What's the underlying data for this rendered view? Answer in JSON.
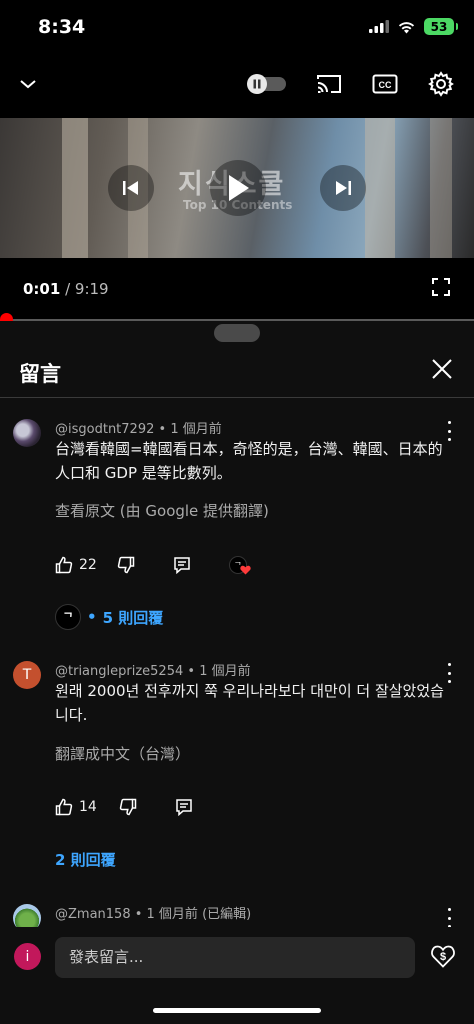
{
  "status": {
    "time": "8:34",
    "battery": "53"
  },
  "player": {
    "video_title": "지식스쿨",
    "video_subtitle": "Top 10 Contents",
    "current_time": "0:01",
    "separator": " / ",
    "duration": "9:19",
    "progress_fraction": 0.002,
    "cc_label": "CC"
  },
  "comments_sheet": {
    "title": "留言",
    "comments": [
      {
        "author": "@isgodtnt7292",
        "age": "1 個月前",
        "text": "台灣看韓國=韓國看日本，奇怪的是，台灣、韓國、日本的人口和 GDP 是等比數列。",
        "translate": "查看原文 (由 Google 提供翻譯)",
        "likes": "22",
        "replies": "5 則回覆"
      },
      {
        "author": "@triangleprize5254",
        "age": "1 個月前",
        "avatar_letter": "T",
        "text": "원래 2000년 전후까지 쭉 우리나라보다 대만이 더 잘살았었습니다.",
        "translate": "翻譯成中文（台灣）",
        "likes": "14",
        "replies": "2 則回覆"
      },
      {
        "author": "@Zman158",
        "age": "1 個月前 (已編輯)"
      }
    ]
  },
  "compose": {
    "avatar_letter": "i",
    "placeholder": "發表留言..."
  },
  "colors": {
    "accent_red": "#ff0000",
    "link_blue": "#3ea6ff",
    "sheet_bg": "#0f0f0f"
  }
}
